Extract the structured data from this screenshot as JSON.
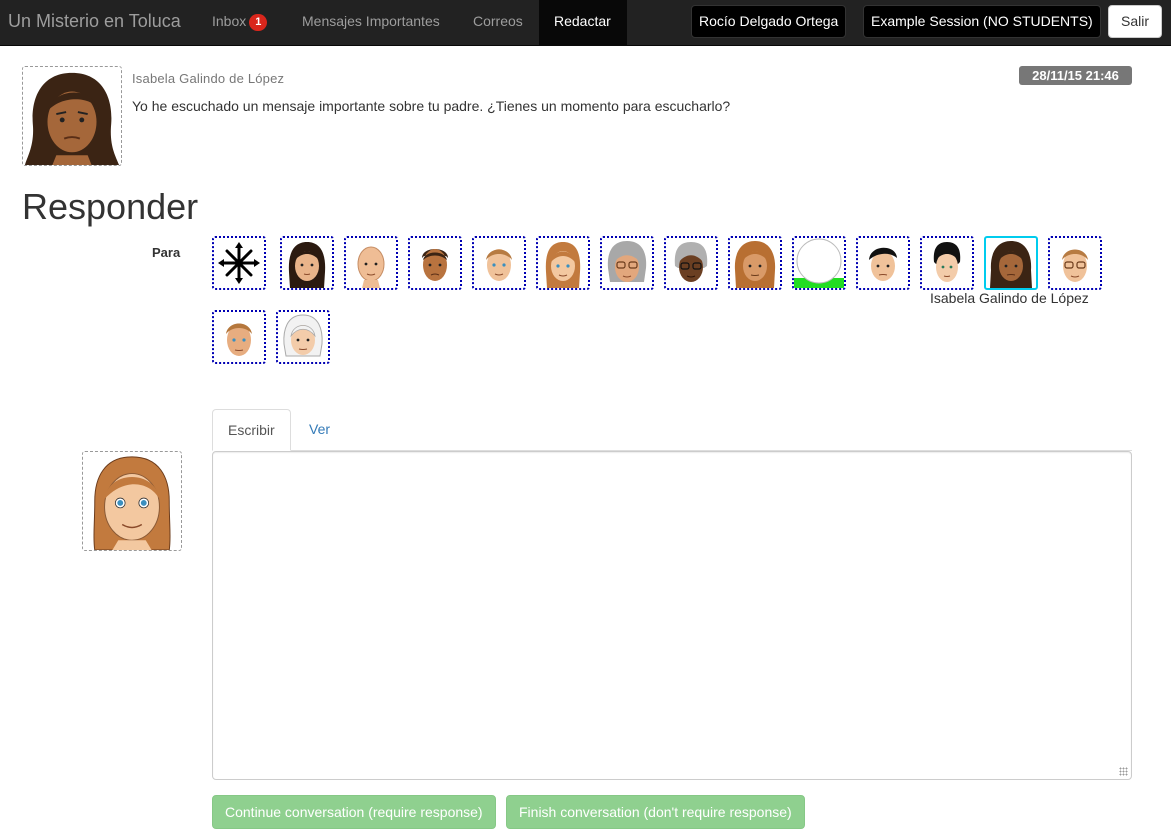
{
  "navbar": {
    "brand": "Un Misterio en Toluca",
    "items": [
      {
        "label": "Inbox",
        "badge": "1"
      },
      {
        "label": "Mensajes Importantes"
      },
      {
        "label": "Correos"
      },
      {
        "label": "Redactar",
        "active": true
      }
    ],
    "user_button": "Rocío Delgado Ortega",
    "session_button": "Example Session (NO STUDENTS)",
    "logout_button": "Salir"
  },
  "message": {
    "sender": "Isabela Galindo de López",
    "text": "Yo he escuchado un mensaje importante sobre tu padre. ¿Tienes un momento para escucharlo?",
    "date": "28/11/15 21:46"
  },
  "reply": {
    "heading": "Responder",
    "to_label": "Para",
    "recipients": [
      {
        "icon": "all-recipients-icon"
      },
      {
        "icon": "avatar-dark-hair-woman"
      },
      {
        "icon": "avatar-bald-man"
      },
      {
        "icon": "avatar-brown-man"
      },
      {
        "icon": "avatar-light-man"
      },
      {
        "icon": "avatar-long-hair-woman"
      },
      {
        "icon": "avatar-gray-hair-glasses-woman"
      },
      {
        "icon": "avatar-dark-skin-gray-hair-woman"
      },
      {
        "icon": "avatar-brown-long-hair-man"
      },
      {
        "icon": "avatar-blank-green"
      },
      {
        "icon": "avatar-black-hair-man"
      },
      {
        "icon": "avatar-black-hair-woman"
      },
      {
        "icon": "avatar-isabela",
        "selected": true
      },
      {
        "icon": "avatar-glasses-man"
      },
      {
        "icon": "avatar-short-hair-man"
      },
      {
        "icon": "avatar-white-hair-woman"
      }
    ],
    "selected_name": "Isabela Galindo de López",
    "tabs": [
      {
        "label": "Escribir",
        "active": true
      },
      {
        "label": "Ver"
      }
    ],
    "compose_value": "",
    "continue_button": "Continue conversation (require response)",
    "finish_button": "Finish conversation (don't require response)"
  },
  "colors": {
    "navbar_bg": "#222222",
    "inbox_badge": "#d9261c",
    "recipient_border": "#0000b3",
    "recipient_selected": "#00ccee",
    "date_badge": "#777777",
    "button_green": "#8fd08f",
    "link": "#337ab7"
  }
}
